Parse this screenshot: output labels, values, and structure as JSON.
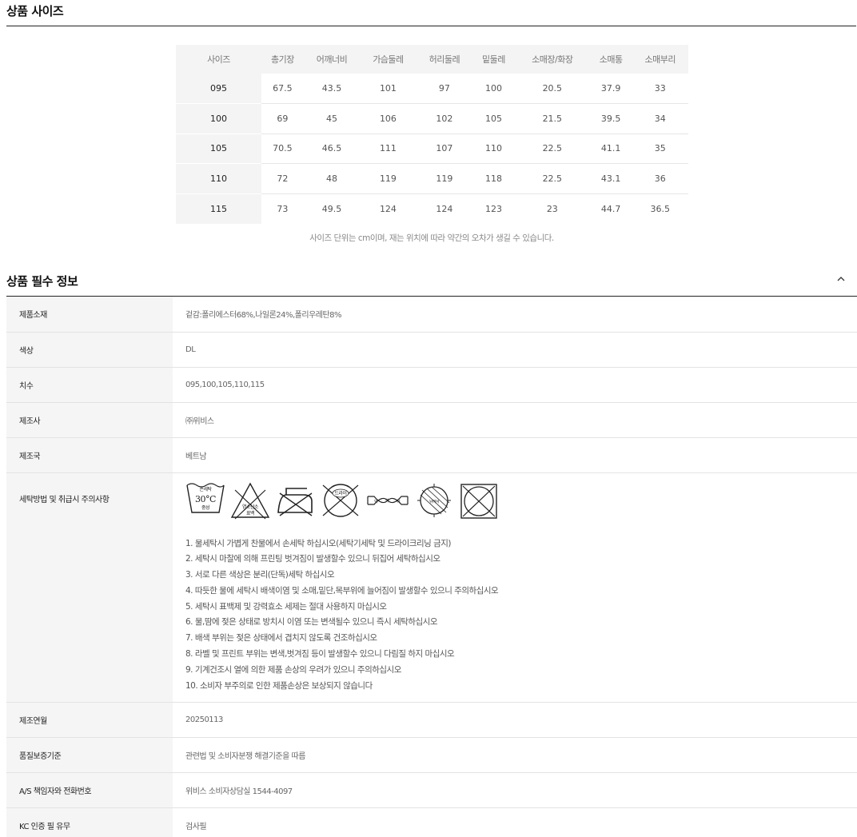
{
  "size_section": {
    "title": "상품 사이즈",
    "headers": [
      "사이즈",
      "총기장",
      "어깨너비",
      "가슴둘레",
      "허리둘레",
      "밑둘레",
      "소매장/화장",
      "소매통",
      "소매부리"
    ],
    "rows": [
      [
        "095",
        "67.5",
        "43.5",
        "101",
        "97",
        "100",
        "20.5",
        "37.9",
        "33"
      ],
      [
        "100",
        "69",
        "45",
        "106",
        "102",
        "105",
        "21.5",
        "39.5",
        "34"
      ],
      [
        "105",
        "70.5",
        "46.5",
        "111",
        "107",
        "110",
        "22.5",
        "41.1",
        "35"
      ],
      [
        "110",
        "72",
        "48",
        "119",
        "119",
        "118",
        "22.5",
        "43.1",
        "36"
      ],
      [
        "115",
        "73",
        "49.5",
        "124",
        "124",
        "123",
        "23",
        "44.7",
        "36.5"
      ]
    ],
    "note": "사이즈 단위는 cm이며, 재는 위치에 따라 약간의 오차가 생길 수 있습니다."
  },
  "info_section": {
    "title": "상품 필수 정보",
    "collapse_icon": "chevron-up-icon",
    "rows": [
      {
        "label": "제품소재",
        "value": "겉감:폴리에스터68%,나일론24%,폴리우레탄8%"
      },
      {
        "label": "색상",
        "value": "DL"
      },
      {
        "label": "치수",
        "value": "095,100,105,110,115"
      },
      {
        "label": "제조사",
        "value": "㈜위비스"
      },
      {
        "label": "제조국",
        "value": "베트남"
      }
    ],
    "care": {
      "label": "세탁방법 및 취급시 주의사항",
      "icons": {
        "hand_wash_top": "손세탁",
        "hand_wash_temp": "30°C",
        "hand_wash_bottom": "중성",
        "bleach_top": "염소산소",
        "bleach_bottom": "표백",
        "iron": "iron-no-icon",
        "dry_clean": "드라이",
        "wring": "약",
        "wring_right": "하",
        "tumble": "기계건조",
        "shade_dry": "뉘어서"
      },
      "notes": [
        "1. 물세탁시 가볍게 찬물에서 손세탁 하십시오(세탁기세탁 및 드라이크리닝 금지)",
        "2. 세탁시 마찰에 의해 프린팅 벗겨짐이 발생할수 있으니 뒤집어 세탁하십시오",
        "3. 서로 다른 색상은 분리(단독)세탁 하십시오",
        "4. 따듯한 물에 세탁시 배색이염 및 소매,밑단,목부위에 늘어짐이 발생할수 있으니 주의하십시오",
        "5. 세탁시 표백제 및 강력효소 세제는 절대 사용하지 마십시오",
        "6. 물,땀에 젖은 상태로 방치시 이염 또는 변색될수 있으니 즉시 세탁하십시오",
        "7. 배색 부위는 젖은 상태에서 겹치지 않도록 건조하십시오",
        "8. 라벨 및 프린트 부위는 변색,벗겨짐 등이 발생할수 있으니 다림질 하지 마십시오",
        "9. 기계건조시 열에 의한 제품 손상의 우려가 있으니 주의하십시오",
        "10. 소비자 부주의로 인한 제품손상은 보상되지 않습니다"
      ]
    },
    "rows_after": [
      {
        "label": "제조연월",
        "value": "20250113"
      },
      {
        "label": "품질보증기준",
        "value": "관련법 및 소비자분쟁 해결기준을 따름"
      },
      {
        "label": "A/S 책임자와 전화번호",
        "value": "위비스 소비자상담실 1544-4097"
      },
      {
        "label": "KC 인증 필 유무",
        "value": "검사필"
      }
    ]
  }
}
